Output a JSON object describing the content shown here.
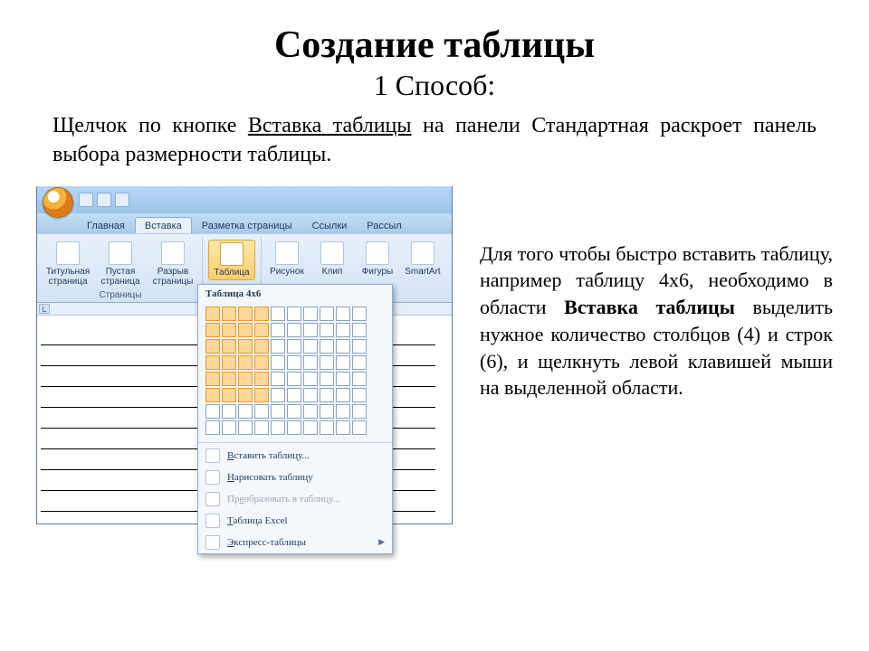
{
  "title": "Создание таблицы",
  "subtitle": "1 Способ:",
  "intro_pre": "Щелчок по кнопке ",
  "intro_underlined": "Вставка таблицы",
  "intro_post": " на панели Стандартная раскроет панель выбора размерности таблицы.",
  "right_p1": "Для того чтобы быстро вставить таблицу, например таблицу 4х6, необходимо в области ",
  "right_bold": "Вставка таблицы",
  "right_p2": " выделить нужное количество столбцов (4) и строк (6), и щелкнуть левой клавишей мыши на выделенной области.",
  "word": {
    "tabs": [
      "Главная",
      "Вставка",
      "Разметка страницы",
      "Ссылки",
      "Рассыл"
    ],
    "active_tab": 1,
    "groups": {
      "pages_label": "Страницы",
      "titlepage": "Титульная страница",
      "blankpage": "Пустая страница",
      "pagebreak": "Разрыв страницы",
      "table": "Таблица",
      "picture": "Рисунок",
      "clip": "Клип",
      "shapes": "Фигуры",
      "smartart": "SmartArt"
    },
    "ruler_label": "L"
  },
  "dropdown": {
    "title": "Таблица 4x6",
    "grid_cols": 10,
    "grid_rows": 8,
    "sel_cols": 4,
    "sel_rows": 6,
    "items": [
      {
        "label_pre": "",
        "u": "В",
        "label_post": "ставить таблицу...",
        "disabled": false,
        "arrow": false
      },
      {
        "label_pre": "",
        "u": "Н",
        "label_post": "арисовать таблицу",
        "disabled": false,
        "arrow": false
      },
      {
        "label_pre": "Пр",
        "u": "е",
        "label_post": "образовать в таблицу...",
        "disabled": true,
        "arrow": false
      },
      {
        "label_pre": "",
        "u": "Т",
        "label_post": "аблица Excel",
        "disabled": false,
        "arrow": false
      },
      {
        "label_pre": "",
        "u": "Э",
        "label_post": "кспресс-таблицы",
        "disabled": false,
        "arrow": true
      }
    ]
  }
}
